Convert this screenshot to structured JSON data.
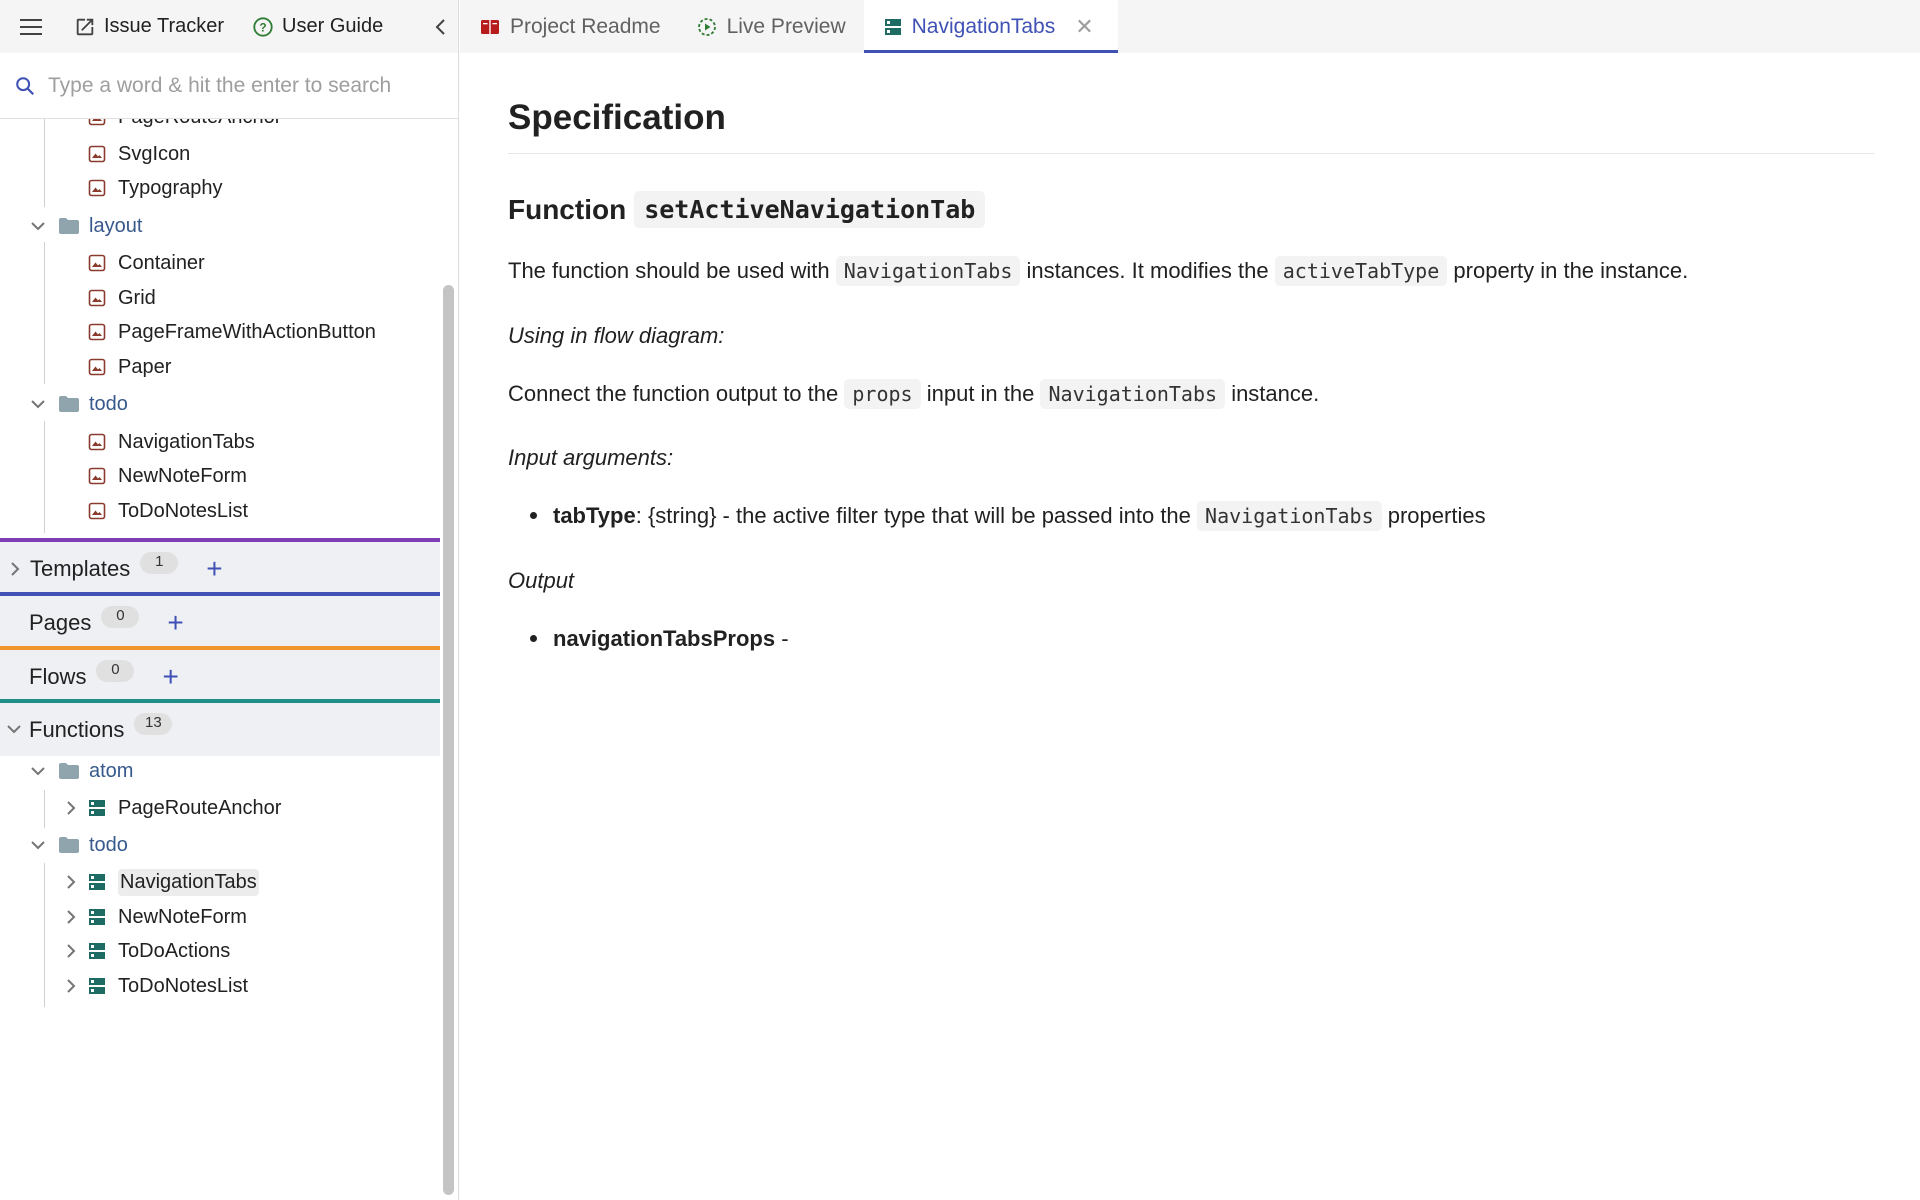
{
  "sidebar": {
    "top_links": [
      {
        "label": "Issue Tracker",
        "icon": "external-link-icon"
      },
      {
        "label": "User Guide",
        "icon": "help-circle-icon"
      }
    ],
    "search_placeholder": "Type a word & hit the enter to search",
    "components_tree": {
      "partial_item": "PageRouteAnchor",
      "items_a": [
        "SvgIcon",
        "Typography"
      ],
      "folder_layout": "layout",
      "layout_items": [
        "Container",
        "Grid",
        "PageFrameWithActionButton",
        "Paper"
      ],
      "folder_todo": "todo",
      "todo_items": [
        "NavigationTabs",
        "NewNoteForm",
        "ToDoNotesList"
      ]
    },
    "sections": {
      "templates": {
        "title": "Templates",
        "count": "1"
      },
      "pages": {
        "title": "Pages",
        "count": "0"
      },
      "flows": {
        "title": "Flows",
        "count": "0"
      },
      "functions": {
        "title": "Functions",
        "count": "13"
      }
    },
    "functions_tree": {
      "folder_atom": "atom",
      "atom_items": [
        "PageRouteAnchor"
      ],
      "folder_todo": "todo",
      "todo_items": [
        "NavigationTabs",
        "NewNoteForm",
        "ToDoActions",
        "ToDoNotesList"
      ]
    }
  },
  "tabs": [
    {
      "label": "Project Readme",
      "icon": "book-icon",
      "active": false
    },
    {
      "label": "Live Preview",
      "icon": "play-circle-icon",
      "active": false
    },
    {
      "label": "NavigationTabs",
      "icon": "function-icon",
      "active": true
    }
  ],
  "doc": {
    "title": "Specification",
    "function_label": "Function",
    "function_name": "setActiveNavigationTab",
    "p1": {
      "a": "The function should be used with",
      "code1": "NavigationTabs",
      "b": "instances. It modifies the",
      "code2": "activeTabType",
      "c": "property in the instance."
    },
    "using_label": "Using in flow diagram:",
    "p2": {
      "a": "Connect the function output to the",
      "code1": "props",
      "b": "input in the",
      "code2": "NavigationTabs",
      "c": "instance."
    },
    "input_label": "Input arguments:",
    "arg": {
      "name": "tabType",
      "desc": ": {string} - the active filter type that will be passed into the",
      "code": "NavigationTabs",
      "tail": "properties"
    },
    "output_label": "Output",
    "out": {
      "name": "navigationTabsProps",
      "tail": " -"
    }
  },
  "colors": {
    "accent": "#3f51b5",
    "templates_border": "#7e3fb5",
    "pages_border": "#f0952b",
    "flows_border": "#1f8f87",
    "function_icon": "#1e6b63",
    "component_icon": "#8a3b2d"
  }
}
